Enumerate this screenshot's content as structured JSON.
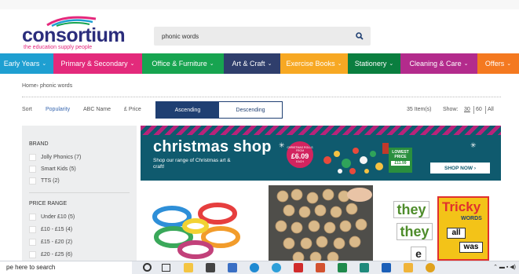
{
  "header": {
    "logo_name": "consortium",
    "logo_tagline": "the education supply people",
    "search_value": "phonic words"
  },
  "nav": [
    {
      "label": "Early Years",
      "color": "#1e9fd1"
    },
    {
      "label": "Primary & Secondary",
      "color": "#e32a7b"
    },
    {
      "label": "Office & Furniture",
      "color": "#17a450"
    },
    {
      "label": "Art & Craft",
      "color": "#2f3e6c"
    },
    {
      "label": "Exercise Books",
      "color": "#f7a823"
    },
    {
      "label": "Stationery",
      "color": "#0a7e3f"
    },
    {
      "label": "Cleaning & Care",
      "color": "#b32b8c"
    },
    {
      "label": "Offers",
      "color": "#f47920"
    }
  ],
  "breadcrumb": "Home› phonic words",
  "sort": {
    "label": "Sort",
    "options": [
      "Popularity",
      "ABC Name",
      "£ Price"
    ],
    "ascending": "Ascending",
    "descending": "Descending",
    "item_count": "35 Item(s)",
    "show_label": "Show:",
    "show_options": [
      "30",
      "60",
      "All"
    ]
  },
  "sidebar": {
    "brand_title": "BRAND",
    "brands": [
      "Jolly Phonics (7)",
      "Smart Kids (5)",
      "TTS (2)"
    ],
    "price_title": "PRICE RANGE",
    "prices": [
      "Under £10 (5)",
      "£10 - £15 (4)",
      "£15 - £20 (2)",
      "£20 - £25 (6)"
    ]
  },
  "banner": {
    "title": "christmas shop",
    "subtitle": "Shop our range of Christmas art & craft!",
    "badge_small": "CHRISTMAS ROLLS FROM",
    "badge_price": "£6.09",
    "badge_each": "EACH",
    "lowest_label": "LOWEST PRICE",
    "lowest_price": "£11.99",
    "cta": "SHOP NOW ›"
  },
  "products": [
    {
      "alt": "Phonics word rings"
    },
    {
      "alt": "Wooden phonics discs"
    },
    {
      "alt": "Tricky Words",
      "box_title": "Tricky",
      "box_sub": "WORDS",
      "words": [
        "they",
        "they",
        "all",
        "was",
        "e"
      ]
    }
  ],
  "taskbar": {
    "search_placeholder": "pe here to search"
  }
}
